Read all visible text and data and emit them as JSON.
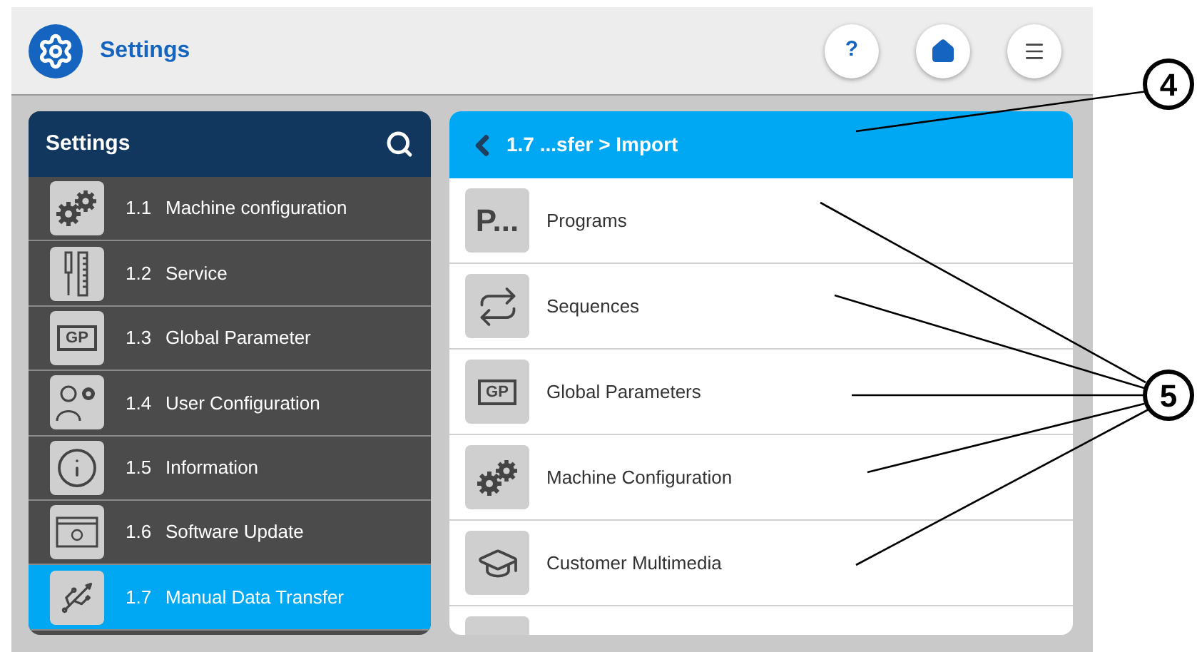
{
  "header": {
    "title": "Settings",
    "buttons": [
      {
        "kind": "help",
        "label": "?"
      },
      {
        "kind": "home"
      },
      {
        "kind": "menu"
      }
    ]
  },
  "sidebar": {
    "title": "Settings",
    "items": [
      {
        "number": "1.1",
        "label": "Machine configuration",
        "kind": "gears",
        "selected": false
      },
      {
        "number": "1.2",
        "label": "Service",
        "kind": "tools",
        "selected": false
      },
      {
        "number": "1.3",
        "label": "Global Parameter",
        "kind": "gp",
        "icon_text": "GP",
        "selected": false
      },
      {
        "number": "1.4",
        "label": "User Configuration",
        "kind": "user",
        "selected": false
      },
      {
        "number": "1.5",
        "label": "Information",
        "kind": "info",
        "selected": false
      },
      {
        "number": "1.6",
        "label": "Software Update",
        "kind": "update",
        "selected": false
      },
      {
        "number": "1.7",
        "label": "Manual Data Transfer",
        "kind": "usb",
        "selected": true
      }
    ]
  },
  "content": {
    "breadcrumb": "1.7 ...sfer > Import",
    "items": [
      {
        "label": "Programs",
        "kind": "text",
        "icon_text": "P..."
      },
      {
        "label": "Sequences",
        "kind": "repeat"
      },
      {
        "label": "Global Parameters",
        "kind": "gp",
        "icon_text": "GP"
      },
      {
        "label": "Machine Configuration",
        "kind": "gears"
      },
      {
        "label": "Customer Multimedia",
        "kind": "graduate"
      },
      {
        "kind": "partial"
      }
    ]
  },
  "callouts": [
    {
      "label": "4"
    },
    {
      "label": "5"
    }
  ]
}
